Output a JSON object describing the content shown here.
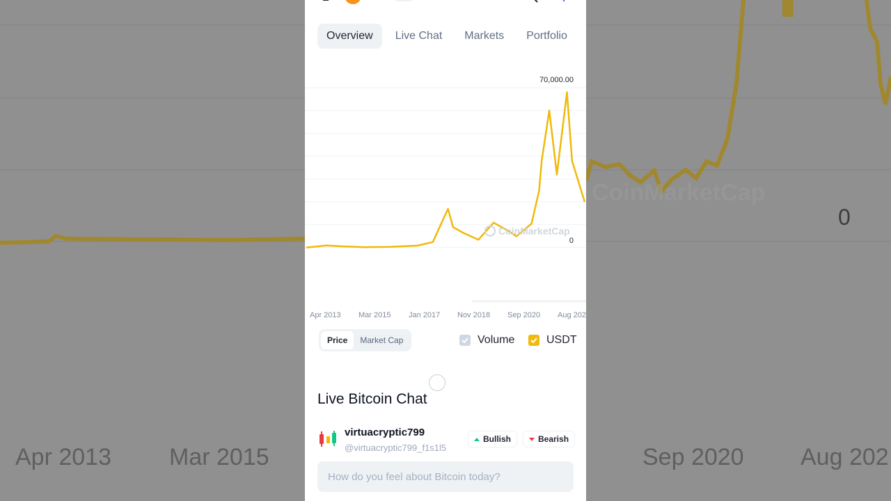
{
  "tabs": [
    {
      "label": "Overview",
      "active": true
    },
    {
      "label": "Live Chat",
      "active": false
    },
    {
      "label": "Markets",
      "active": false
    },
    {
      "label": "Portfolio",
      "active": false
    }
  ],
  "chart_data": {
    "type": "line",
    "series": [
      {
        "x": [
          "2013-04",
          "2013-12",
          "2014-06",
          "2015-03",
          "2016-01",
          "2016-12",
          "2017-06",
          "2017-12",
          "2018-02",
          "2018-06",
          "2018-12",
          "2019-06",
          "2019-12",
          "2020-03",
          "2020-09",
          "2020-12",
          "2021-01",
          "2021-04",
          "2021-07",
          "2021-11",
          "2022-01",
          "2022-06"
        ],
        "values": [
          100,
          1000,
          600,
          250,
          400,
          900,
          2500,
          17000,
          9000,
          6500,
          3500,
          11000,
          7200,
          5000,
          10500,
          25000,
          38000,
          60000,
          32000,
          68000,
          38000,
          20000
        ]
      }
    ],
    "x_tick_labels": [
      "Apr 2013",
      "Mar 2015",
      "Jan 2017",
      "Nov 2018",
      "Sep 2020",
      "Aug 202"
    ],
    "y_tick_labels": [
      "70,000.00",
      "0"
    ],
    "ylim": [
      0,
      70000
    ],
    "line_color": "#f0b90b",
    "grid": true
  },
  "watermark": "CoinMarketCap",
  "chart_toggle": {
    "price_label": "Price",
    "market_cap_label": "Market Cap"
  },
  "legend": [
    {
      "label": "Volume",
      "checked": true,
      "color": "#cfd6e4"
    },
    {
      "label": "USDT",
      "checked": true,
      "color": "#f0b90b"
    }
  ],
  "live_chat": {
    "title": "Live Bitcoin Chat",
    "username": "virtuacryptic799",
    "handle": "@virtuacryptic799_f1s1l5",
    "bullish_label": "Bullish",
    "bearish_label": "Bearish",
    "input_placeholder": "How do you feel about Bitcoin today?"
  },
  "background": {
    "tick_labels": [
      "Apr 2013",
      "Mar 2015",
      "Sep 2020",
      "Aug 202"
    ],
    "zero_label": "0",
    "watermark": "CoinMarketCap"
  },
  "colors": {
    "accent": "#3861fb",
    "price": "#f0b90b",
    "bullish": "#16c784",
    "bearish": "#ea3943"
  }
}
